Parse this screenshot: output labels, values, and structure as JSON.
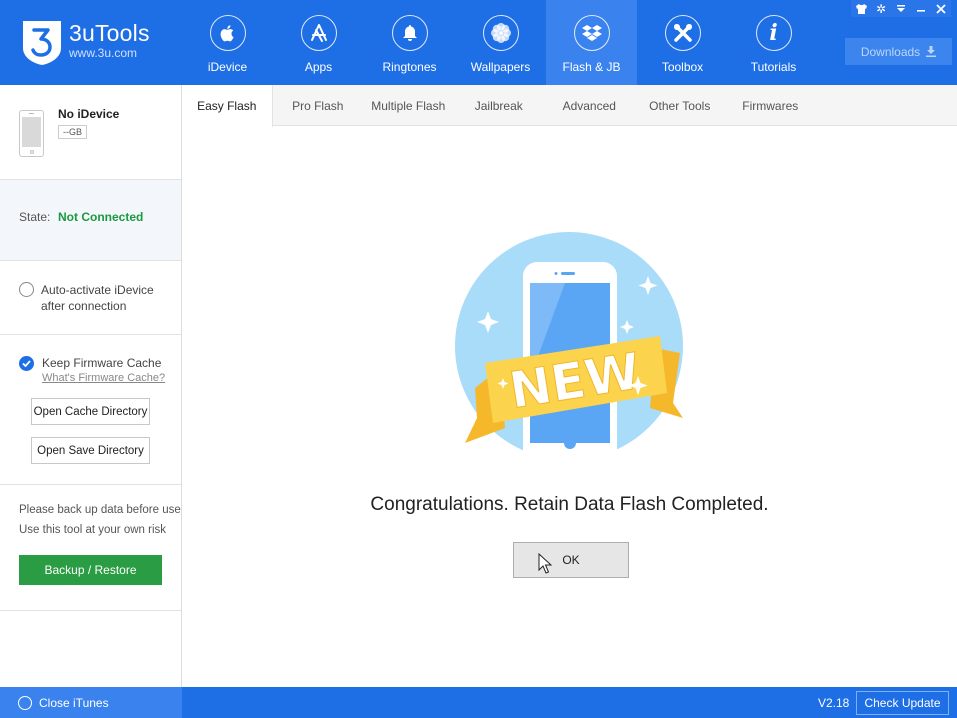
{
  "app": {
    "name": "3uTools",
    "url": "www.3u.com"
  },
  "nav": {
    "items": [
      {
        "label": "iDevice",
        "icon": "apple-icon"
      },
      {
        "label": "Apps",
        "icon": "app-store-icon"
      },
      {
        "label": "Ringtones",
        "icon": "bell-icon"
      },
      {
        "label": "Wallpapers",
        "icon": "flower-icon"
      },
      {
        "label": "Flash & JB",
        "icon": "dropbox-box-icon",
        "active": true
      },
      {
        "label": "Toolbox",
        "icon": "tools-icon"
      },
      {
        "label": "Tutorials",
        "icon": "info-icon"
      }
    ],
    "downloads_label": "Downloads"
  },
  "window_controls": [
    "skin-icon",
    "settings-icon",
    "menu-icon",
    "minimize-icon",
    "close-icon"
  ],
  "sidebar": {
    "device_name": "No iDevice",
    "capacity": "--GB",
    "state_label": "State:",
    "state_value": "Not Connected",
    "auto_activate": "Auto-activate iDevice",
    "auto_activate_2": "after connection",
    "keep_cache": "Keep Firmware Cache",
    "cache_link": "What's Firmware Cache?",
    "open_cache_dir": "Open Cache Directory",
    "open_save_dir": "Open Save Directory",
    "warning_1": "Please back up data before use",
    "warning_2": "Use this tool at your own risk",
    "backup_restore": "Backup / Restore"
  },
  "tabs": [
    {
      "label": "Easy Flash",
      "active": true
    },
    {
      "label": "Pro Flash"
    },
    {
      "label": "Multiple Flash"
    },
    {
      "label": "Jailbreak"
    },
    {
      "label": "Advanced"
    },
    {
      "label": "Other Tools"
    },
    {
      "label": "Firmwares"
    }
  ],
  "main": {
    "badge_text": "NEW",
    "message": "Congratulations. Retain Data Flash Completed.",
    "ok_label": "OK"
  },
  "footer": {
    "close_itunes": "Close iTunes",
    "version": "V2.18",
    "check_update": "Check Update"
  },
  "colors": {
    "brand_blue": "#1e6ee6",
    "active_nav": "#3a83ef",
    "success_green": "#1a9a3e",
    "backup_green": "#2a9d44"
  }
}
